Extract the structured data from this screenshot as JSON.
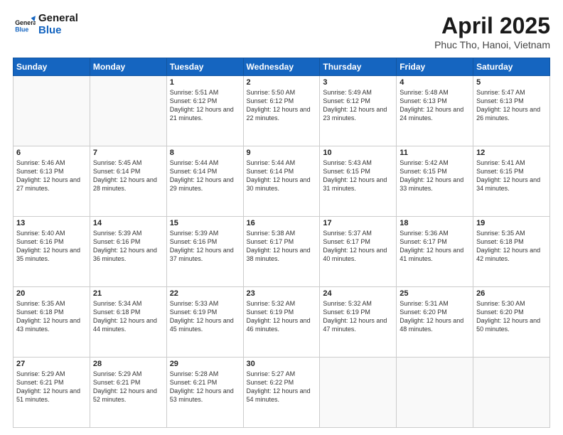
{
  "header": {
    "logo_line1": "General",
    "logo_line2": "Blue",
    "month": "April 2025",
    "location": "Phuc Tho, Hanoi, Vietnam"
  },
  "weekdays": [
    "Sunday",
    "Monday",
    "Tuesday",
    "Wednesday",
    "Thursday",
    "Friday",
    "Saturday"
  ],
  "weeks": [
    [
      {
        "day": "",
        "info": ""
      },
      {
        "day": "",
        "info": ""
      },
      {
        "day": "1",
        "info": "Sunrise: 5:51 AM\nSunset: 6:12 PM\nDaylight: 12 hours and 21 minutes."
      },
      {
        "day": "2",
        "info": "Sunrise: 5:50 AM\nSunset: 6:12 PM\nDaylight: 12 hours and 22 minutes."
      },
      {
        "day": "3",
        "info": "Sunrise: 5:49 AM\nSunset: 6:12 PM\nDaylight: 12 hours and 23 minutes."
      },
      {
        "day": "4",
        "info": "Sunrise: 5:48 AM\nSunset: 6:13 PM\nDaylight: 12 hours and 24 minutes."
      },
      {
        "day": "5",
        "info": "Sunrise: 5:47 AM\nSunset: 6:13 PM\nDaylight: 12 hours and 26 minutes."
      }
    ],
    [
      {
        "day": "6",
        "info": "Sunrise: 5:46 AM\nSunset: 6:13 PM\nDaylight: 12 hours and 27 minutes."
      },
      {
        "day": "7",
        "info": "Sunrise: 5:45 AM\nSunset: 6:14 PM\nDaylight: 12 hours and 28 minutes."
      },
      {
        "day": "8",
        "info": "Sunrise: 5:44 AM\nSunset: 6:14 PM\nDaylight: 12 hours and 29 minutes."
      },
      {
        "day": "9",
        "info": "Sunrise: 5:44 AM\nSunset: 6:14 PM\nDaylight: 12 hours and 30 minutes."
      },
      {
        "day": "10",
        "info": "Sunrise: 5:43 AM\nSunset: 6:15 PM\nDaylight: 12 hours and 31 minutes."
      },
      {
        "day": "11",
        "info": "Sunrise: 5:42 AM\nSunset: 6:15 PM\nDaylight: 12 hours and 33 minutes."
      },
      {
        "day": "12",
        "info": "Sunrise: 5:41 AM\nSunset: 6:15 PM\nDaylight: 12 hours and 34 minutes."
      }
    ],
    [
      {
        "day": "13",
        "info": "Sunrise: 5:40 AM\nSunset: 6:16 PM\nDaylight: 12 hours and 35 minutes."
      },
      {
        "day": "14",
        "info": "Sunrise: 5:39 AM\nSunset: 6:16 PM\nDaylight: 12 hours and 36 minutes."
      },
      {
        "day": "15",
        "info": "Sunrise: 5:39 AM\nSunset: 6:16 PM\nDaylight: 12 hours and 37 minutes."
      },
      {
        "day": "16",
        "info": "Sunrise: 5:38 AM\nSunset: 6:17 PM\nDaylight: 12 hours and 38 minutes."
      },
      {
        "day": "17",
        "info": "Sunrise: 5:37 AM\nSunset: 6:17 PM\nDaylight: 12 hours and 40 minutes."
      },
      {
        "day": "18",
        "info": "Sunrise: 5:36 AM\nSunset: 6:17 PM\nDaylight: 12 hours and 41 minutes."
      },
      {
        "day": "19",
        "info": "Sunrise: 5:35 AM\nSunset: 6:18 PM\nDaylight: 12 hours and 42 minutes."
      }
    ],
    [
      {
        "day": "20",
        "info": "Sunrise: 5:35 AM\nSunset: 6:18 PM\nDaylight: 12 hours and 43 minutes."
      },
      {
        "day": "21",
        "info": "Sunrise: 5:34 AM\nSunset: 6:18 PM\nDaylight: 12 hours and 44 minutes."
      },
      {
        "day": "22",
        "info": "Sunrise: 5:33 AM\nSunset: 6:19 PM\nDaylight: 12 hours and 45 minutes."
      },
      {
        "day": "23",
        "info": "Sunrise: 5:32 AM\nSunset: 6:19 PM\nDaylight: 12 hours and 46 minutes."
      },
      {
        "day": "24",
        "info": "Sunrise: 5:32 AM\nSunset: 6:19 PM\nDaylight: 12 hours and 47 minutes."
      },
      {
        "day": "25",
        "info": "Sunrise: 5:31 AM\nSunset: 6:20 PM\nDaylight: 12 hours and 48 minutes."
      },
      {
        "day": "26",
        "info": "Sunrise: 5:30 AM\nSunset: 6:20 PM\nDaylight: 12 hours and 50 minutes."
      }
    ],
    [
      {
        "day": "27",
        "info": "Sunrise: 5:29 AM\nSunset: 6:21 PM\nDaylight: 12 hours and 51 minutes."
      },
      {
        "day": "28",
        "info": "Sunrise: 5:29 AM\nSunset: 6:21 PM\nDaylight: 12 hours and 52 minutes."
      },
      {
        "day": "29",
        "info": "Sunrise: 5:28 AM\nSunset: 6:21 PM\nDaylight: 12 hours and 53 minutes."
      },
      {
        "day": "30",
        "info": "Sunrise: 5:27 AM\nSunset: 6:22 PM\nDaylight: 12 hours and 54 minutes."
      },
      {
        "day": "",
        "info": ""
      },
      {
        "day": "",
        "info": ""
      },
      {
        "day": "",
        "info": ""
      }
    ]
  ]
}
